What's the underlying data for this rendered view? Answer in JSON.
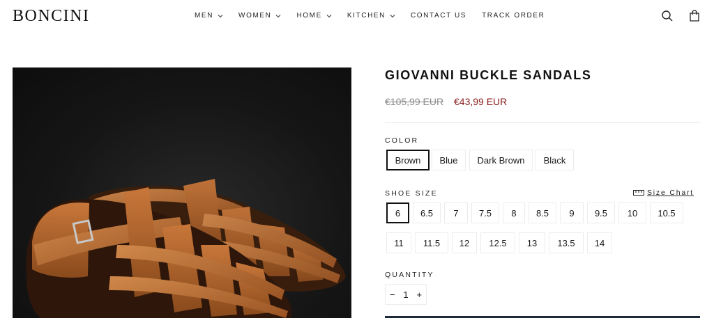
{
  "header": {
    "logo": "BONCINI",
    "nav": [
      {
        "label": "MEN",
        "has_dropdown": true
      },
      {
        "label": "WOMEN",
        "has_dropdown": true
      },
      {
        "label": "HOME",
        "has_dropdown": true
      },
      {
        "label": "KITCHEN",
        "has_dropdown": true
      },
      {
        "label": "CONTACT US",
        "has_dropdown": false
      },
      {
        "label": "TRACK ORDER",
        "has_dropdown": false
      }
    ],
    "icons": [
      "search-icon",
      "cart-icon"
    ]
  },
  "product": {
    "title": "GIOVANNI BUCKLE SANDALS",
    "price_old": "€105,99 EUR",
    "price_new": "€43,99 EUR",
    "sale_color": "#8b1a1a",
    "color": {
      "label": "COLOR",
      "options": [
        "Brown",
        "Blue",
        "Dark Brown",
        "Black"
      ],
      "selected": "Brown"
    },
    "size": {
      "label": "SHOE SIZE",
      "size_chart_label": "Size Chart",
      "options_row1": [
        "6",
        "6.5",
        "7",
        "7.5",
        "8",
        "8.5",
        "9",
        "9.5",
        "10",
        "10.5"
      ],
      "options_row2": [
        "11",
        "11.5",
        "12",
        "12.5",
        "13",
        "13.5",
        "14"
      ],
      "selected": "6"
    },
    "quantity": {
      "label": "QUANTITY",
      "minus": "−",
      "value": "1",
      "plus": "+"
    }
  }
}
